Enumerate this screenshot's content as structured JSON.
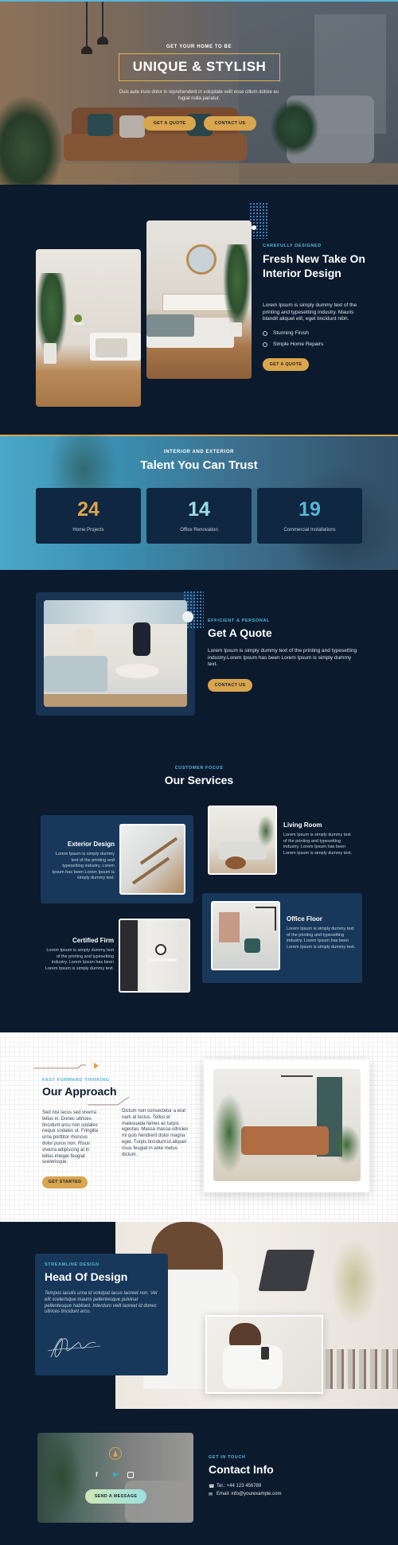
{
  "colors": {
    "navy": "#0c1a2e",
    "card": "#17385a",
    "gold": "#d9a54d",
    "cyan": "#55b7d8",
    "mint": "#9be0e0"
  },
  "hero": {
    "kicker": "GET YOUR HOME TO BE",
    "title": "UNIQUE & STYLISH",
    "subtitle": "Duis aute irure dolor in reprehenderit in voluptate velit esse cillum dolore eu fugiat nulla pariatur.",
    "quote_button": "GET A QUOTE",
    "contact_button": "CONTACT US"
  },
  "fresh": {
    "kicker": "CAREFULLY DESIGNED",
    "title": "Fresh New Take On Interior Design",
    "text": "Lorem Ipsum is simply dummy text of the printing and typesetting industry. Mauris blandit aliquet elit, eget tincidunt nibh.",
    "features": [
      "Stunning Finish",
      "Simple Home Repairs"
    ],
    "button": "GET A QUOTE"
  },
  "talent": {
    "kicker": "INTERIOR AND EXTERIOR",
    "title": "Talent You Can Trust",
    "stats": [
      {
        "value": "24",
        "label": "Home Projects",
        "color": "#d9a54d"
      },
      {
        "value": "14",
        "label": "Office Renovation",
        "color": "#9be0e0"
      },
      {
        "value": "19",
        "label": "Commercial Installations",
        "color": "#55b7d8"
      }
    ]
  },
  "quote": {
    "kicker": "EFFICIENT & PERSONAL",
    "title": "Get A Quote",
    "text": "Lorem Ipsum is simply dummy text of the printing and typesetting industry.Lorem Ipsum has been Lorem Ipsum is simply dummy text.",
    "button": "CONTACT US"
  },
  "services": {
    "kicker": "CUSTOMER FOCUS",
    "title": "Our Services",
    "items": [
      {
        "title": "Exterior Design",
        "text": "Lorem Ipsum is simply dummy text of the printing and typesetting industry. Lorem Ipsum has been Lorem Ipsum is simply dummy text."
      },
      {
        "title": "Living Room",
        "text": "Lorem Ipsum is simply dummy text of the printing and typesetting industry. Lorem Ipsum has been Lorem Ipsum is simply dummy text."
      },
      {
        "title": "Certified Firm",
        "text": "Lorem Ipsum is simply dummy text of the printing and typesetting industry. Lorem Ipsum has been Lorem Ipsum is simply dummy text."
      },
      {
        "title": "Office Floor",
        "text": "Lorem Ipsum is simply dummy text of the printing and typesetting industry. Lorem Ipsum has been Lorem Ipsum is simply dummy text."
      }
    ]
  },
  "approach": {
    "kicker": "FAST FORWARD THINKING",
    "title": "Our Approach",
    "col1": "Sed nisi lacus sed viverra tellus in. Donec ultrices tincidunt arcu non sodales neque sodales ut. Fringilla urna porttitor rhoncus dolor purus non. Risus viverra adipiscing at in tellus integer feugiat scelerisque.",
    "col2": "Dictum non consectetur a erat nam at lectus. Tellus et malesuada fames ac turpis egestas. Massa massa ultricies mi quis hendrerit dolor magna eget. Turpis tincidunt id aliquet risus feugiat in ante metus dictum.",
    "button": "GET STARTED"
  },
  "head_of_design": {
    "kicker": "STREAMLINE DESIGN",
    "title": "Head Of Design",
    "text": "Tempus iaculis urna id volutpat lacus laoreet non. Vel elit scelerisque mauris pellentesque pulvinar pellentesque habitant. Interdum velit laoreet id donec ultrices tincidunt arcu."
  },
  "contact": {
    "kicker": "GET IN TOUCH",
    "title": "Contact Info",
    "phone": "Tel.: +44 123 456789",
    "email": "Email: info@yourexample.com",
    "button": "SEND A MESSAGE",
    "social": [
      "facebook-icon",
      "twitter-icon",
      "instagram-icon"
    ]
  }
}
